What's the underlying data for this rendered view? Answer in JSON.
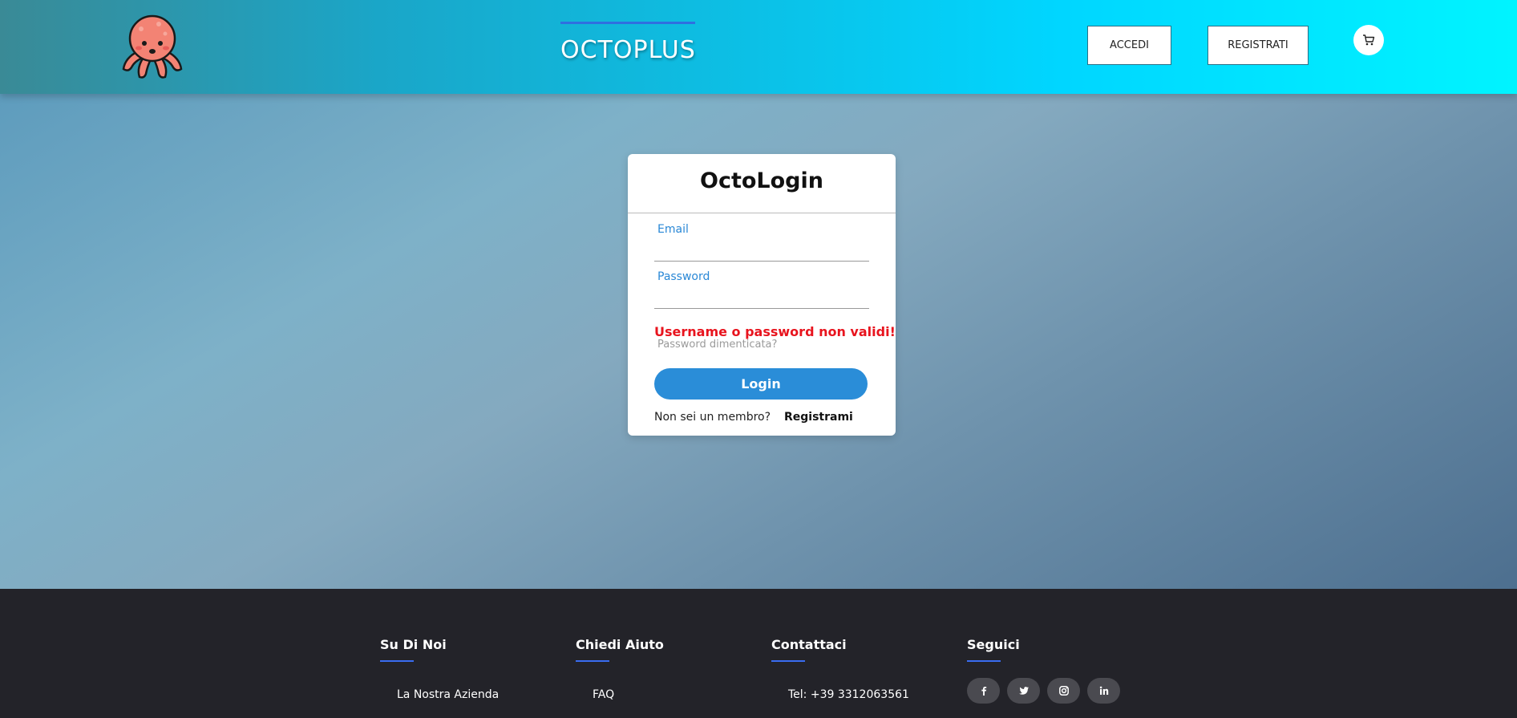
{
  "header": {
    "brand": "OCTOPLUS",
    "accedi_label": "ACCEDI",
    "registrati_label": "REGISTRATI",
    "logo_icon": "octopus-logo-icon",
    "cart_icon": "cart-icon"
  },
  "login": {
    "title": "OctoLogin",
    "email_label": "Email",
    "email_value": "",
    "password_label": "Password",
    "password_value": "",
    "error": "Username o password non validi!",
    "forgot": "Password dimenticata?",
    "submit_label": "Login",
    "member_text": "Non sei un membro?",
    "signup_label": "Registrami"
  },
  "footer": {
    "columns": [
      {
        "title": "Su Di Noi",
        "item": "La Nostra Azienda"
      },
      {
        "title": "Chiedi Aiuto",
        "item": "FAQ"
      },
      {
        "title": "Contattaci",
        "item": "Tel: +39 3312063561"
      },
      {
        "title": "Seguici"
      }
    ],
    "social_icons": [
      "facebook-icon",
      "twitter-icon",
      "instagram-icon",
      "linkedin-icon"
    ]
  },
  "colors": {
    "accent": "#2a8dd8",
    "error": "#e8141e",
    "footer_bg": "#232329",
    "footer_underline": "#3a6cf0"
  }
}
